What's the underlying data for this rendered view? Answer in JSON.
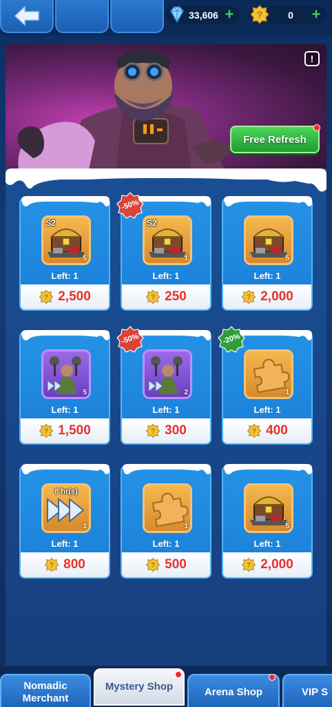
{
  "topbar": {
    "gems": "33,606",
    "gold": "0"
  },
  "banner": {
    "info_label": "!",
    "refresh_label": "Free Refresh"
  },
  "shop": {
    "items": [
      {
        "tag": "S2",
        "qty": "5",
        "left": "Left: 1",
        "price": "2,500",
        "discount": "",
        "art": "chest-icon"
      },
      {
        "tag": "S2",
        "qty": "1",
        "left": "Left: 1",
        "price": "250",
        "discount": "-50%",
        "art": "chest-icon"
      },
      {
        "tag": "",
        "qty": "5",
        "left": "Left: 1",
        "price": "2,000",
        "discount": "",
        "art": "chest-icon"
      },
      {
        "tag": "",
        "qty": "5",
        "left": "Left: 1",
        "price": "1,500",
        "discount": "",
        "art": "hero-training-icon"
      },
      {
        "tag": "",
        "qty": "2",
        "left": "Left: 1",
        "price": "300",
        "discount": "-50%",
        "art": "hero-training-icon"
      },
      {
        "tag": "",
        "qty": "1",
        "left": "Left: 1",
        "price": "400",
        "discount": "-20%",
        "art": "puzzle-piece-icon"
      },
      {
        "tag": "8 hr(s)",
        "qty": "1",
        "left": "Left: 1",
        "price": "800",
        "discount": "",
        "art": "speedup-icon"
      },
      {
        "tag": "",
        "qty": "1",
        "left": "Left: 1",
        "price": "500",
        "discount": "",
        "art": "puzzle-piece-icon"
      },
      {
        "tag": "",
        "qty": "5",
        "left": "Left: 1",
        "price": "2,000",
        "discount": "",
        "art": "chest-icon"
      }
    ]
  },
  "tabs": [
    {
      "label": "Nomadic Merchant"
    },
    {
      "label": "Mystery Shop"
    },
    {
      "label": "Arena Shop"
    },
    {
      "label": "VIP S"
    }
  ],
  "colors": {
    "price_red": "#e8322c",
    "discount_red": "#d9433a",
    "discount_green": "#2f9e3a",
    "refresh_green": "#2fb445"
  }
}
